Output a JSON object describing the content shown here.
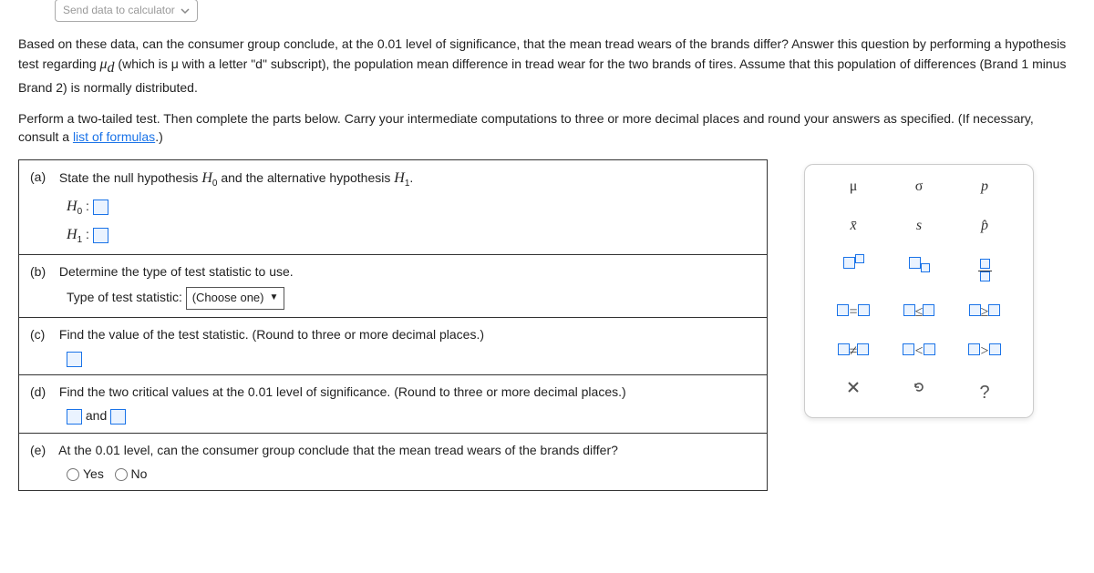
{
  "top_button": "Send data to calculator",
  "intro_p1a": "Based on these data, can the consumer group conclude, at the ",
  "intro_sig1": "0.01",
  "intro_p1b": " level of significance, that the mean tread wears of the brands differ? Answer this question by performing a hypothesis test regarding ",
  "mu_d": "μ",
  "mu_d_sub": "d",
  "intro_p1c": " (which is μ with a letter \"d\" subscript), the population mean difference in tread wear for the two brands of tires. Assume that this population of differences (Brand 1 minus Brand 2) is normally distributed.",
  "intro_p2a": "Perform a two-tailed test. Then complete the parts below. Carry your intermediate computations to three or more decimal places and round your answers as specified. (If necessary, consult a ",
  "intro_link": "list of formulas",
  "intro_p2b": ".)",
  "parts": {
    "a": {
      "letter": "(a)",
      "text_a": "State the null hypothesis ",
      "H0": "H",
      "H0s": "0",
      "text_b": " and the alternative hypothesis ",
      "H1": "H",
      "H1s": "1",
      "text_c": ".",
      "h0_label": "H",
      "h0_sub": "0",
      "h1_label": "H",
      "h1_sub": "1",
      "colon": " :"
    },
    "b": {
      "letter": "(b)",
      "text": "Determine the type of test statistic to use.",
      "label": "Type of test statistic:",
      "choose": "(Choose one)"
    },
    "c": {
      "letter": "(c)",
      "text": "Find the value of the test statistic. (Round to three or more decimal places.)"
    },
    "d": {
      "letter": "(d)",
      "text_a": "Find the two critical values at the ",
      "sig": "0.01",
      "text_b": " level of significance. (Round to three or more decimal places.)",
      "and": " and "
    },
    "e": {
      "letter": "(e)",
      "text_a": "At the ",
      "sig": "0.01",
      "text_b": " level, can the consumer group conclude that the mean tread wears of the brands differ?",
      "yes": "Yes",
      "no": "No"
    }
  },
  "palette": {
    "r1": {
      "c1": "μ",
      "c2": "σ",
      "c3": "p"
    },
    "r2": {
      "c1": "x̄",
      "c2": "s",
      "c3": "p̂"
    },
    "r5": {
      "c1_op": "=",
      "c2_op": "≤",
      "c3_op": "≥"
    },
    "r6": {
      "c1_op": "≠",
      "c2_op": "<",
      "c3_op": ">"
    },
    "r7": {
      "c3": "?"
    }
  }
}
